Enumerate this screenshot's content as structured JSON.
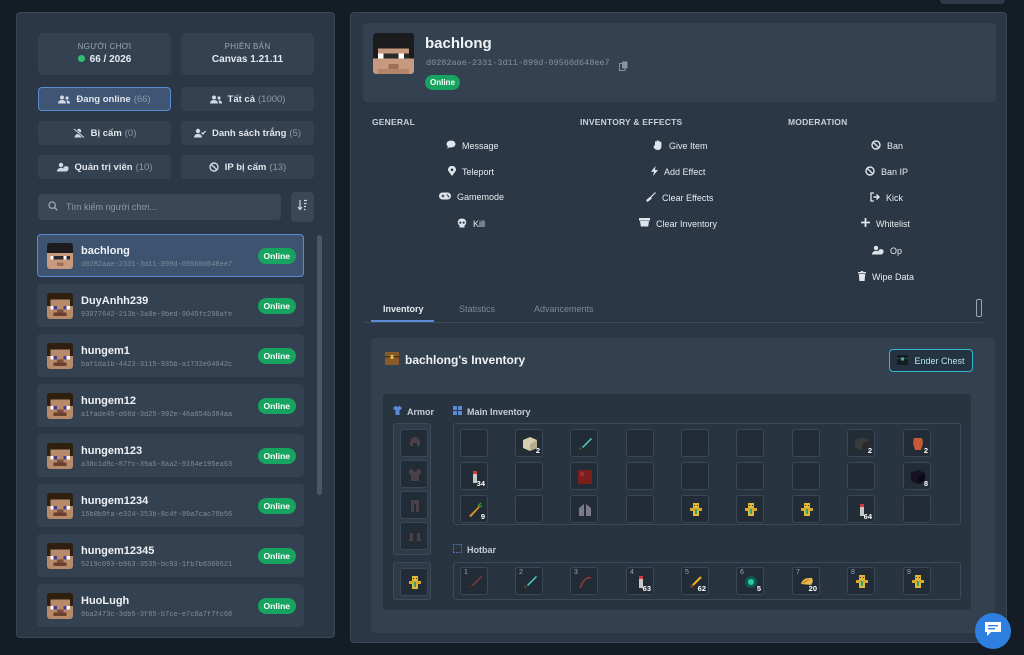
{
  "stats": {
    "players_label": "NGƯỜI CHƠI",
    "players_value": "66 / 2026",
    "version_label": "PHIÊN BẢN",
    "version_value": "Canvas 1.21.11"
  },
  "filters": [
    {
      "label": "Đang online",
      "count": "(66)",
      "icon": "users-icon"
    },
    {
      "label": "Tất cả",
      "count": "(1000)",
      "icon": "users-icon"
    },
    {
      "label": "Bị cấm",
      "count": "(0)",
      "icon": "user-slash-icon"
    },
    {
      "label": "Danh sách trắng",
      "count": "(5)",
      "icon": "user-check-icon"
    },
    {
      "label": "Quản trị viên",
      "count": "(10)",
      "icon": "user-shield-icon"
    },
    {
      "label": "IP bị cấm",
      "count": "(13)",
      "icon": "ban-icon"
    }
  ],
  "search": {
    "placeholder": "Tìm kiếm người chơi..."
  },
  "players": [
    {
      "name": "bachlong",
      "uuid": "d0282aae-2331-3d11-899d-09560d648ee7",
      "status": "Online"
    },
    {
      "name": "DuyAnhh239",
      "uuid": "93077642-213b-3a8e-9bed-9045fc298afe",
      "status": "Online"
    },
    {
      "name": "hungem1",
      "uuid": "baf1da1b-4423-3115-935b-a1732e04042c",
      "status": "Online"
    },
    {
      "name": "hungem12",
      "uuid": "a1fade45-d66d-3d25-992e-46a854b384aa",
      "status": "Online"
    },
    {
      "name": "hungem123",
      "uuid": "a38c1d9c-87fc-39a5-8aa2-9164e195ea63",
      "status": "Online"
    },
    {
      "name": "hungem1234",
      "uuid": "15b0b9fa-e324-353b-8c4f-89a7cac78b56",
      "status": "Online"
    },
    {
      "name": "hungem12345",
      "uuid": "5219c093-b963-3535-bc93-1fb7b6360621",
      "status": "Online"
    },
    {
      "name": "HuoLugh",
      "uuid": "9ba2473c-3db5-3f85-b7ce-e7c8a7f7fc68",
      "status": "Online"
    }
  ],
  "selected": {
    "name": "bachlong",
    "uuid": "d0282aae-2331-3d11-899d-09560d648ee7",
    "status": "Online"
  },
  "actions": {
    "general_title": "GENERAL",
    "inventory_title": "INVENTORY & EFFECTS",
    "moderation_title": "MODERATION",
    "general": [
      "Message",
      "Teleport",
      "Gamemode",
      "Kill"
    ],
    "inventory": [
      "Give Item",
      "Add Effect",
      "Clear Effects",
      "Clear Inventory"
    ],
    "moderation": [
      "Ban",
      "Ban IP",
      "Kick",
      "Whitelist",
      "Op",
      "Wipe Data"
    ]
  },
  "tabs": [
    "Inventory",
    "Statistics",
    "Advancements"
  ],
  "inventory": {
    "title": "bachlong's Inventory",
    "ender_chest": "Ender Chest",
    "armor_label": "Armor",
    "main_label": "Main Inventory",
    "hotbar_label": "Hotbar",
    "main_quantities": [
      "",
      "2",
      "",
      "",
      "",
      "",
      "",
      "2",
      "2",
      "34",
      "",
      "",
      "",
      "",
      "",
      "",
      "",
      "8",
      "9",
      "",
      "",
      "",
      "",
      "",
      "",
      "64"
    ],
    "hotbar_numbers": [
      "1",
      "2",
      "3",
      "4",
      "5",
      "6",
      "7",
      "8",
      "9"
    ],
    "hotbar_quantities": [
      "",
      "",
      "",
      "63",
      "62",
      "5",
      "20",
      "",
      ""
    ]
  },
  "colors": {
    "accent": "#5b8ad6",
    "online": "#17a360",
    "ender": "#33b8d1"
  }
}
